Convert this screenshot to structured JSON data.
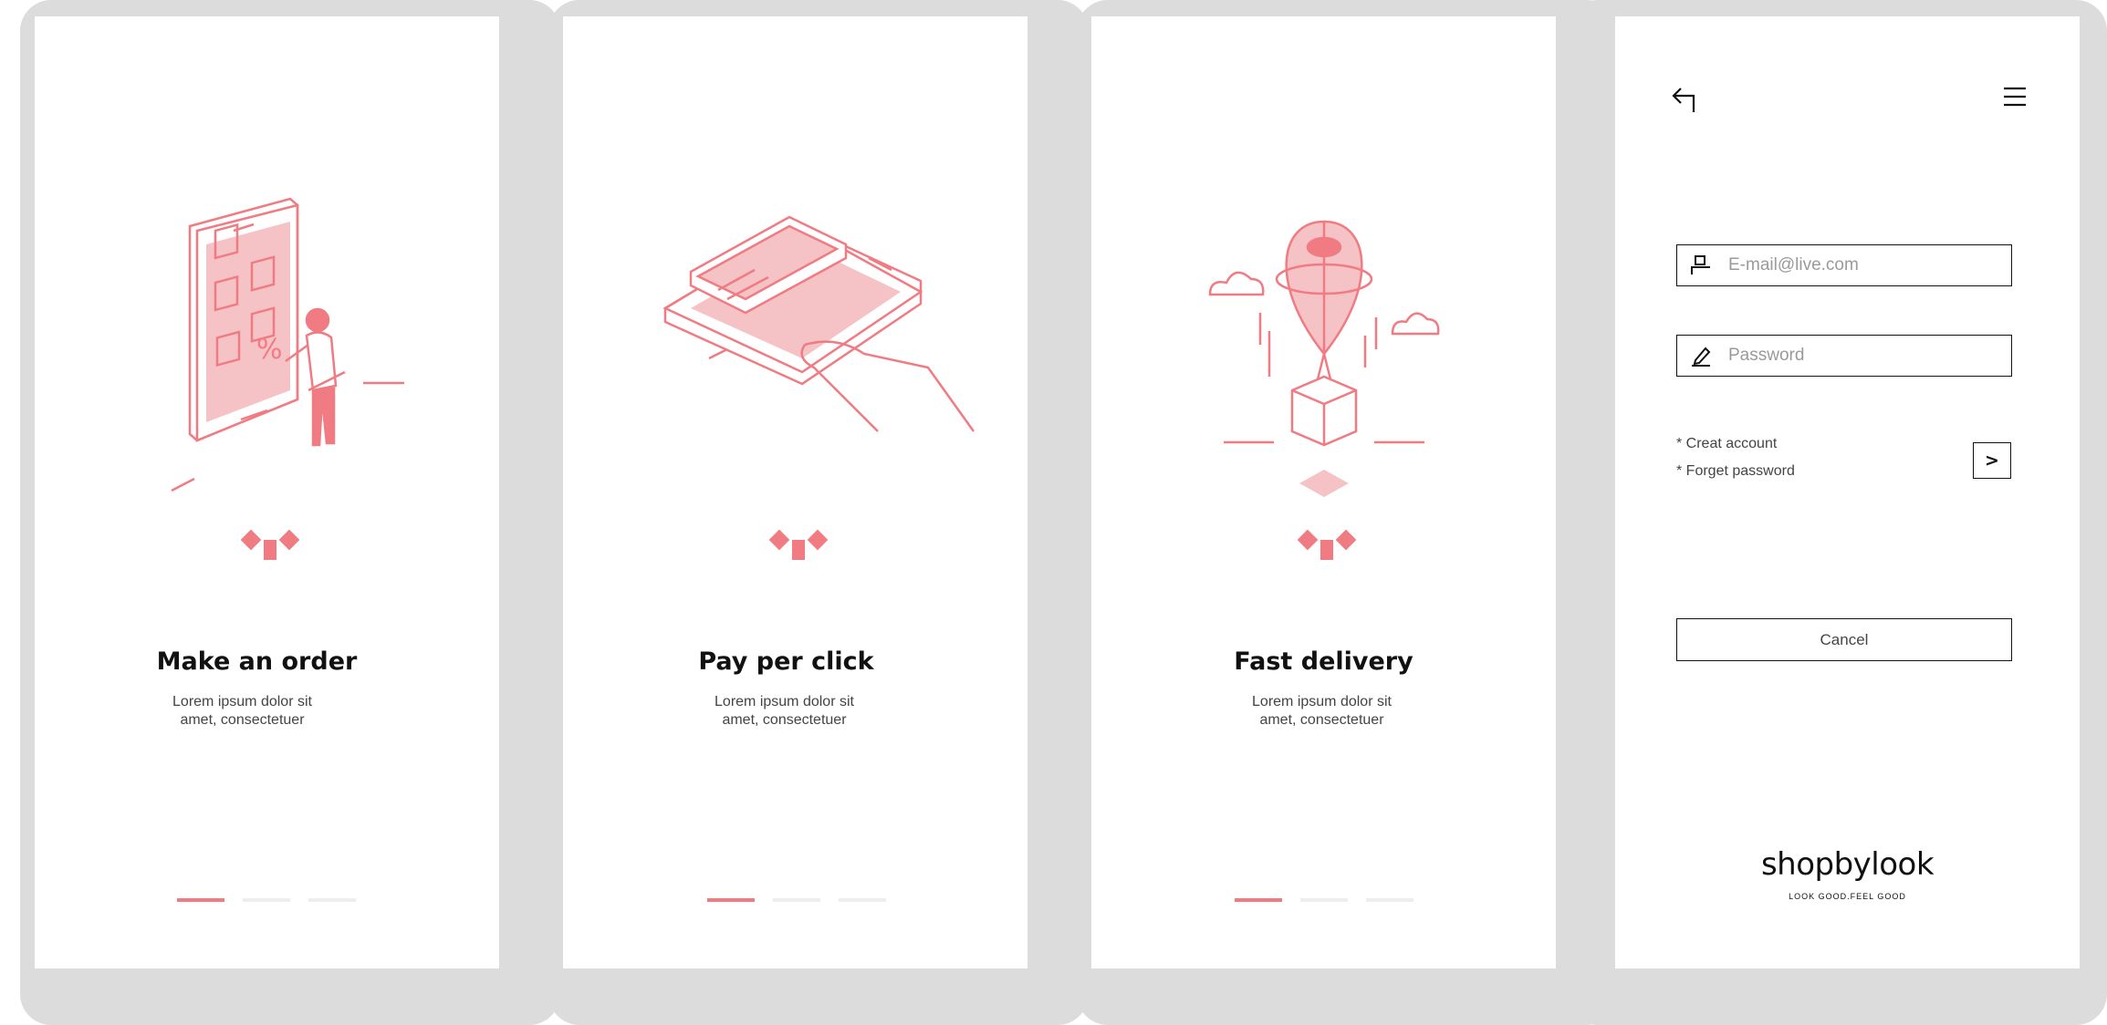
{
  "slides": [
    {
      "title": "Make an order",
      "desc_line1": "Lorem ipsum dolor sit",
      "desc_line2": "amet, consectetuer",
      "illustration": "phone-shopping-icon",
      "active_dot": 1,
      "dot_count": 3
    },
    {
      "title": "Pay per click",
      "desc_line1": "Lorem ipsum dolor sit",
      "desc_line2": "amet, consectetuer",
      "illustration": "card-payment-icon",
      "active_dot": 1,
      "dot_count": 3
    },
    {
      "title": "Fast delivery",
      "desc_line1": "Lorem ipsum dolor sit",
      "desc_line2": "amet, consectetuer",
      "illustration": "balloon-delivery-icon",
      "active_dot": 1,
      "dot_count": 3
    }
  ],
  "login": {
    "back_icon": "back-arrow-icon",
    "menu_icon": "hamburger-menu-icon",
    "email": {
      "placeholder": "E-mail@live.com",
      "value": "",
      "icon": "user-icon"
    },
    "password": {
      "placeholder": "Password",
      "value": "",
      "icon": "pen-icon"
    },
    "create_account": "* Creat account",
    "forget_password": "* Forget password",
    "submit_label": ">",
    "cancel_label": "Cancel",
    "brand": "shopbylook",
    "tagline": "LOOK GOOD.FEEL GOOD"
  },
  "colors": {
    "accent": "#f07b82",
    "accent_light": "#f5c2c5",
    "frame": "#dcdcdc",
    "text": "#111111"
  }
}
